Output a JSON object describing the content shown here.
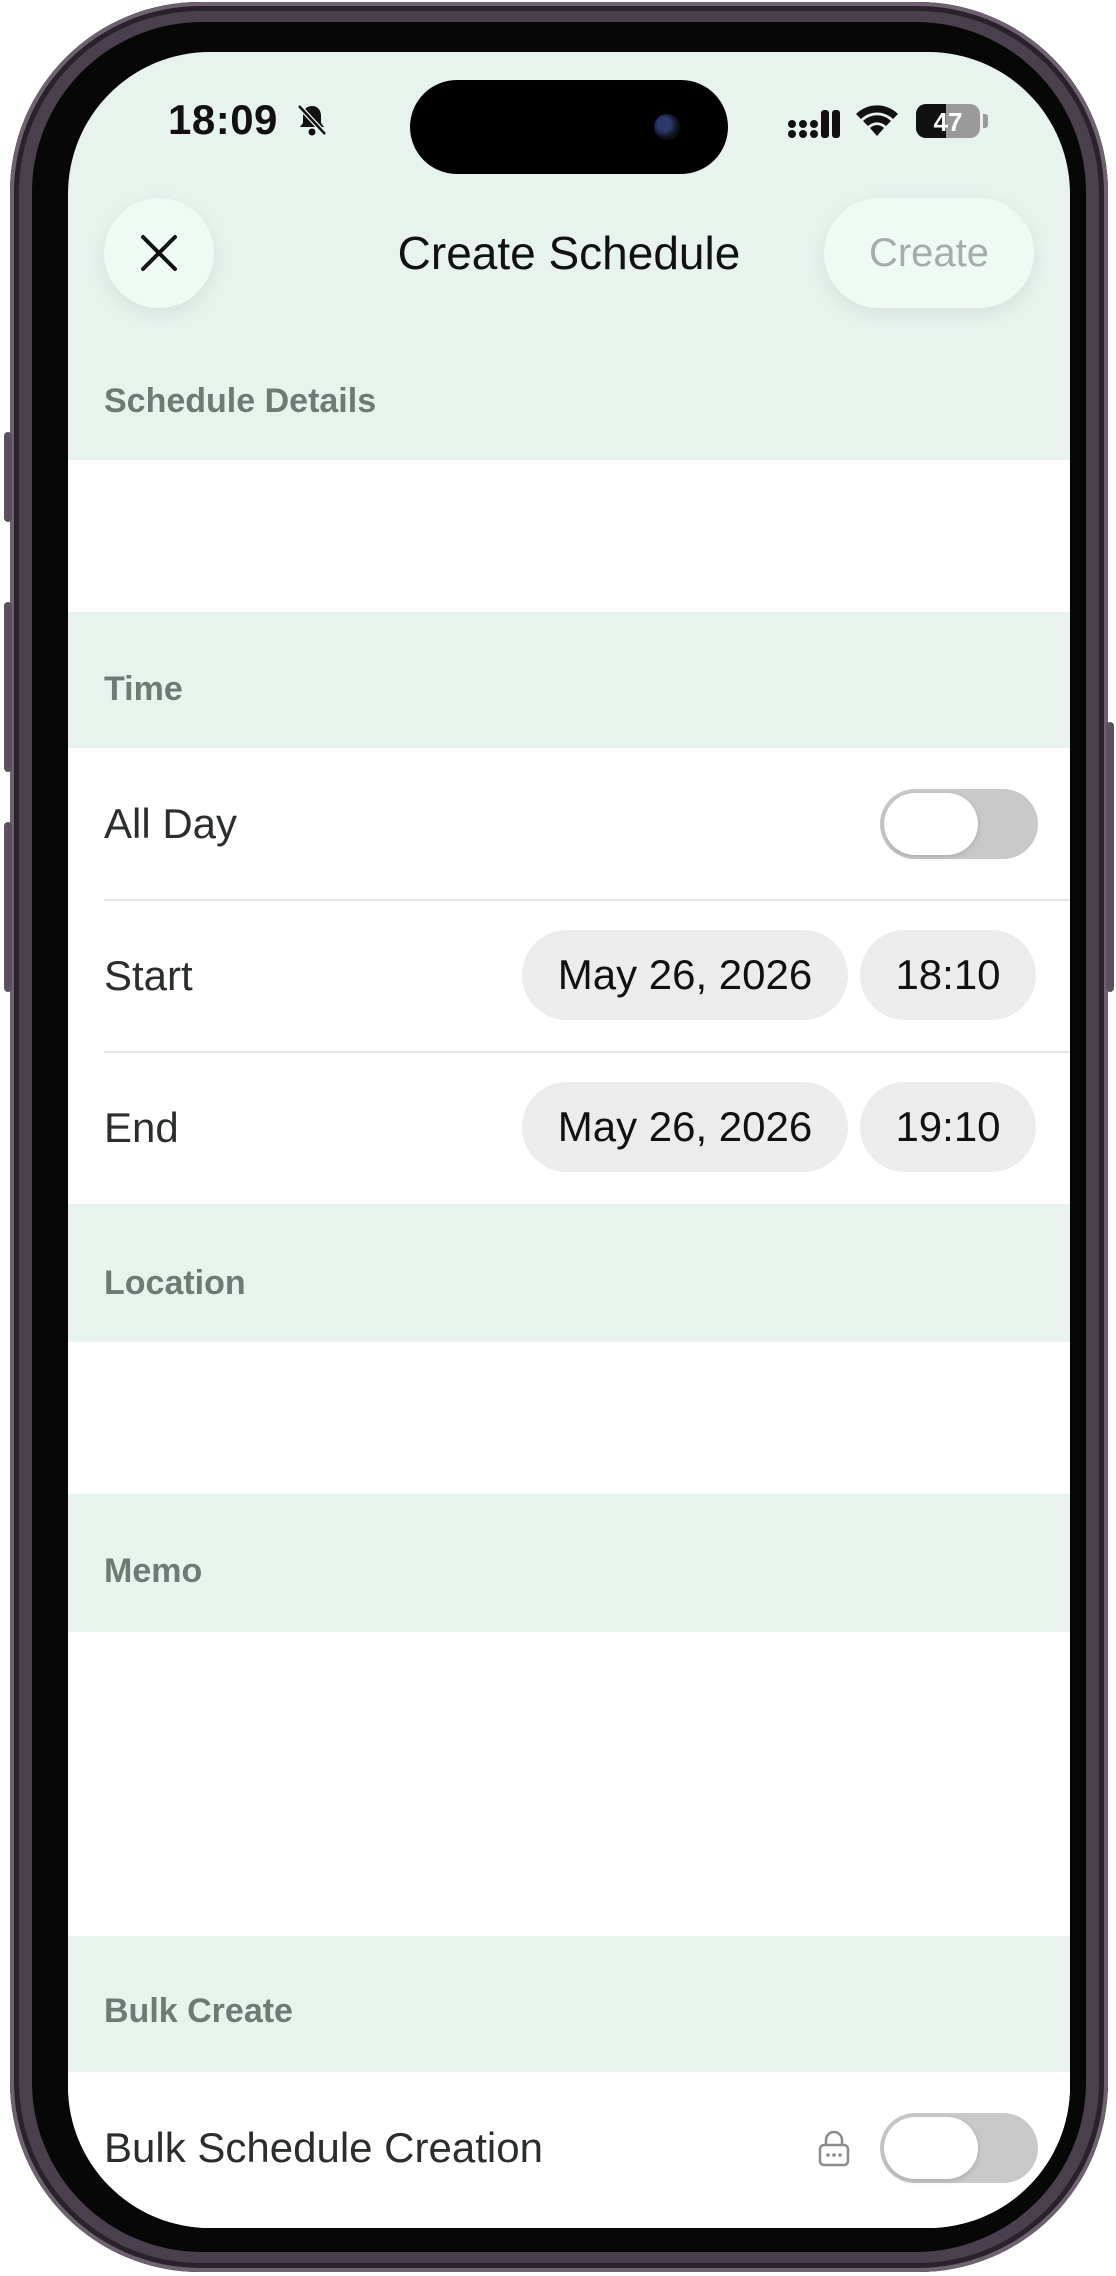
{
  "status_bar": {
    "time": "18:09",
    "battery": "47",
    "battery_level": 0.47
  },
  "nav": {
    "close_icon": "close-icon",
    "title": "Create Schedule",
    "create_label": "Create"
  },
  "sections": {
    "details": {
      "label": "Schedule Details"
    },
    "time": {
      "label": "Time",
      "all_day": {
        "label": "All Day",
        "on": false
      },
      "start": {
        "label": "Start",
        "date": "May 26, 2026",
        "time": "18:10"
      },
      "end": {
        "label": "End",
        "date": "May 26, 2026",
        "time": "19:10"
      }
    },
    "location": {
      "label": "Location"
    },
    "memo": {
      "label": "Memo"
    },
    "bulk": {
      "label": "Bulk Create",
      "bulk_schedule": {
        "label": "Bulk Schedule Creation",
        "on": false,
        "locked": true
      }
    }
  },
  "colors": {
    "accent_bg": "#e9f3ee",
    "button_bg": "#eefaf3",
    "toggle_off": "#c9c9c9",
    "label": "#6f7a75"
  }
}
